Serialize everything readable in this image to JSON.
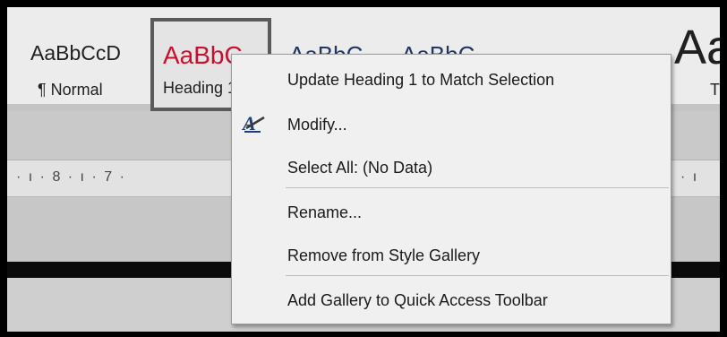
{
  "styles": {
    "normal": {
      "preview": "AaBbCcD",
      "name": "¶ Normal"
    },
    "heading1": {
      "preview": "AaBbC",
      "name": "Heading 1"
    },
    "heading2": {
      "preview": "AaBbC",
      "name": ""
    },
    "title": {
      "preview": "Aa",
      "name": "Ti"
    }
  },
  "ruler": {
    "left": "· ı · 8 · ı · 7 ·",
    "right": "· ı"
  },
  "context_menu": {
    "items": [
      {
        "label": "Update Heading 1 to Match Selection",
        "icon": ""
      },
      {
        "label": "Modify...",
        "icon": "modify-style-icon"
      },
      {
        "label": "Select All: (No Data)",
        "icon": ""
      },
      {
        "label": "Rename...",
        "icon": ""
      },
      {
        "label": "Remove from Style Gallery",
        "icon": ""
      },
      {
        "label": "Add Gallery to Quick Access Toolbar",
        "icon": ""
      }
    ]
  }
}
